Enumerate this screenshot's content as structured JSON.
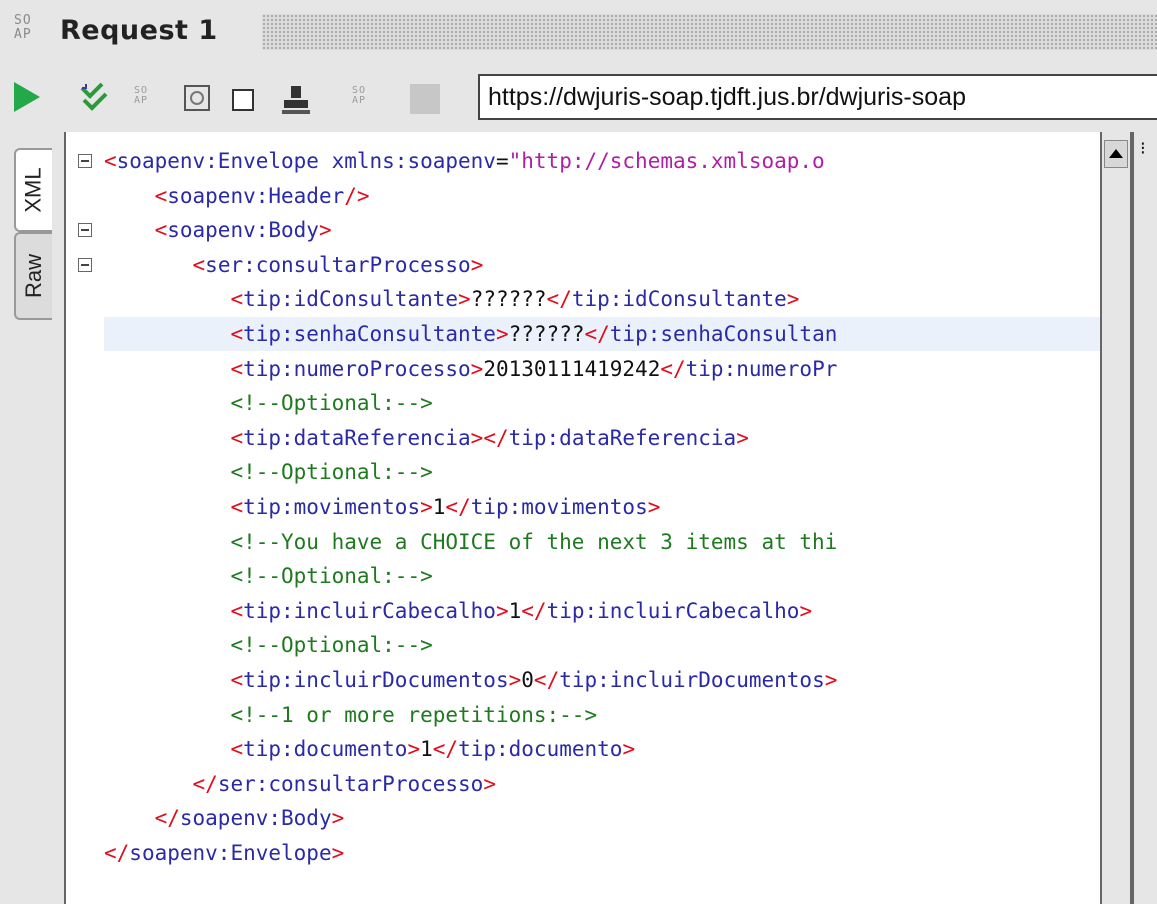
{
  "title": {
    "logo": "SO\nAP",
    "text": "Request 1"
  },
  "toolbar": {
    "url": "https://dwjuris-soap.tjdft.jus.br/dwjuris-soap",
    "icons": [
      "play-icon",
      "validate-icon",
      "soap-icon",
      "wsa-icon",
      "square-icon",
      "person-icon",
      "soap-icon",
      "stop-icon"
    ]
  },
  "tabs": {
    "xml": "XML",
    "raw": "Raw"
  },
  "editor": {
    "lines": [
      [
        [
          "b",
          "<"
        ],
        [
          "t",
          "soapenv:Envelope "
        ],
        [
          "a",
          "xmlns:soapenv"
        ],
        [
          "x",
          "="
        ],
        [
          "v",
          "\"http://schemas.xmlsoap.o"
        ]
      ],
      [
        [
          "x",
          "    "
        ],
        [
          "b",
          "<"
        ],
        [
          "t",
          "soapenv:Header"
        ],
        [
          "b",
          "/>"
        ]
      ],
      [
        [
          "x",
          "    "
        ],
        [
          "b",
          "<"
        ],
        [
          "t",
          "soapenv:Body"
        ],
        [
          "b",
          ">"
        ]
      ],
      [
        [
          "x",
          "       "
        ],
        [
          "b",
          "<"
        ],
        [
          "t",
          "ser:consultarProcesso"
        ],
        [
          "b",
          ">"
        ]
      ],
      [
        [
          "x",
          "          "
        ],
        [
          "b",
          "<"
        ],
        [
          "t",
          "tip:idConsultante"
        ],
        [
          "b",
          ">"
        ],
        [
          "x",
          "??????"
        ],
        [
          "b",
          "</"
        ],
        [
          "t",
          "tip:idConsultante"
        ],
        [
          "b",
          ">"
        ]
      ],
      [
        [
          "x",
          "          "
        ],
        [
          "b",
          "<"
        ],
        [
          "t",
          "tip:senhaConsultante"
        ],
        [
          "b",
          ">"
        ],
        [
          "x",
          "??????"
        ],
        [
          "b",
          "</"
        ],
        [
          "t",
          "tip:senhaConsultan"
        ]
      ],
      [
        [
          "x",
          "          "
        ],
        [
          "b",
          "<"
        ],
        [
          "t",
          "tip:numeroProcesso"
        ],
        [
          "b",
          ">"
        ],
        [
          "x",
          "20130111419242"
        ],
        [
          "b",
          "</"
        ],
        [
          "t",
          "tip:numeroPr"
        ]
      ],
      [
        [
          "x",
          "          "
        ],
        [
          "c",
          "<!--Optional:-->"
        ]
      ],
      [
        [
          "x",
          "          "
        ],
        [
          "b",
          "<"
        ],
        [
          "t",
          "tip:dataReferencia"
        ],
        [
          "b",
          "></"
        ],
        [
          "t",
          "tip:dataReferencia"
        ],
        [
          "b",
          ">"
        ]
      ],
      [
        [
          "x",
          "          "
        ],
        [
          "c",
          "<!--Optional:-->"
        ]
      ],
      [
        [
          "x",
          "          "
        ],
        [
          "b",
          "<"
        ],
        [
          "t",
          "tip:movimentos"
        ],
        [
          "b",
          ">"
        ],
        [
          "x",
          "1"
        ],
        [
          "b",
          "</"
        ],
        [
          "t",
          "tip:movimentos"
        ],
        [
          "b",
          ">"
        ]
      ],
      [
        [
          "x",
          "          "
        ],
        [
          "c",
          "<!--You have a CHOICE of the next 3 items at thi"
        ]
      ],
      [
        [
          "x",
          "          "
        ],
        [
          "c",
          "<!--Optional:-->"
        ]
      ],
      [
        [
          "x",
          "          "
        ],
        [
          "b",
          "<"
        ],
        [
          "t",
          "tip:incluirCabecalho"
        ],
        [
          "b",
          ">"
        ],
        [
          "x",
          "1"
        ],
        [
          "b",
          "</"
        ],
        [
          "t",
          "tip:incluirCabecalho"
        ],
        [
          "b",
          ">"
        ]
      ],
      [
        [
          "x",
          "          "
        ],
        [
          "c",
          "<!--Optional:-->"
        ]
      ],
      [
        [
          "x",
          "          "
        ],
        [
          "b",
          "<"
        ],
        [
          "t",
          "tip:incluirDocumentos"
        ],
        [
          "b",
          ">"
        ],
        [
          "x",
          "0"
        ],
        [
          "b",
          "</"
        ],
        [
          "t",
          "tip:incluirDocumentos"
        ],
        [
          "b",
          ">"
        ]
      ],
      [
        [
          "x",
          "          "
        ],
        [
          "c",
          "<!--1 or more repetitions:-->"
        ]
      ],
      [
        [
          "x",
          "          "
        ],
        [
          "b",
          "<"
        ],
        [
          "t",
          "tip:documento"
        ],
        [
          "b",
          ">"
        ],
        [
          "x",
          "1"
        ],
        [
          "b",
          "</"
        ],
        [
          "t",
          "tip:documento"
        ],
        [
          "b",
          ">"
        ]
      ],
      [
        [
          "x",
          "       "
        ],
        [
          "b",
          "</"
        ],
        [
          "t",
          "ser:consultarProcesso"
        ],
        [
          "b",
          ">"
        ]
      ],
      [
        [
          "x",
          "    "
        ],
        [
          "b",
          "</"
        ],
        [
          "t",
          "soapenv:Body"
        ],
        [
          "b",
          ">"
        ]
      ],
      [
        [
          "b",
          "</"
        ],
        [
          "t",
          "soapenv:Envelope"
        ],
        [
          "b",
          ">"
        ]
      ]
    ],
    "highlighted_line": 6,
    "fold_lines": [
      1,
      3,
      4
    ]
  }
}
